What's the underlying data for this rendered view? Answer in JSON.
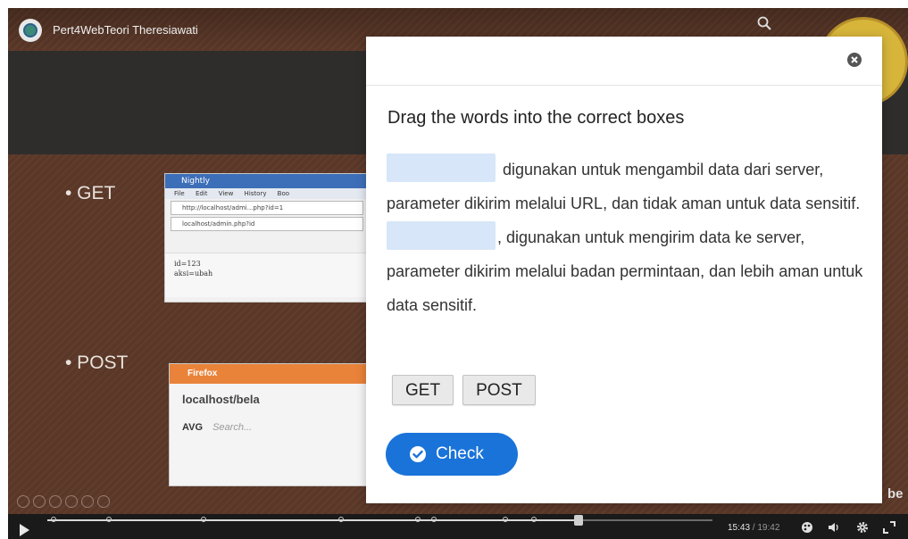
{
  "video": {
    "title": "Pert4WebTeori Theresiawati",
    "slide": {
      "bullet_get": "• GET",
      "bullet_post": "• POST",
      "get_window": {
        "title": "Nightly",
        "menu": "File Edit View History Boo",
        "url": "http://localhost/admi...php?id=1",
        "url2": "localhost/admin.php?id",
        "body_line1": "id=123",
        "body_line2": "aksi=ubah"
      },
      "post_window": {
        "browser": "Firefox",
        "url": "localhost/bela",
        "avg": "AVG",
        "search_placeholder": "Search..."
      }
    },
    "watermark": "be"
  },
  "player": {
    "current_time": "15:43",
    "separator": " / ",
    "duration": "19:42",
    "progress_fraction": 0.798
  },
  "dialog": {
    "instruction": "Drag the words into the correct boxes",
    "sentence1_after_box": "digunakan untuk mengambil data dari server, parameter dikirim melalui URL, dan tidak aman untuk data sensitif.",
    "sentence2_after_box": ", digunakan untuk mengirim data ke server, parameter dikirim melalui badan permintaan, dan lebih aman untuk data sensitif.",
    "words": [
      "GET",
      "POST"
    ],
    "check_label": "Check"
  },
  "colors": {
    "accent": "#1a73d9",
    "drop_box": "#d7e6f8",
    "video_bg": "#5a3727"
  },
  "icons": {
    "close": "close-circle-icon",
    "check": "check-circle-icon",
    "search": "search-icon",
    "play": "play-icon",
    "settings": "gear-icon",
    "volume": "volume-icon",
    "fullscreen": "fullscreen-icon"
  }
}
